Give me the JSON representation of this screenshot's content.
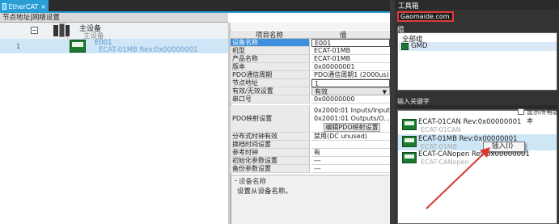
{
  "tab": {
    "label": "EtherCAT",
    "close": "×"
  },
  "left_panel": {
    "header": "节点地址|网络设置",
    "master": {
      "title": "主设备",
      "subtitle": "主设备",
      "collapse": "−"
    },
    "slave": {
      "number": "1",
      "name": "E001",
      "model": "ECAT-01MB Rev:0x00000001"
    }
  },
  "properties": {
    "header": {
      "name": "项目名称",
      "value": "值"
    },
    "rows": [
      {
        "name": "设备名称",
        "value": "E001"
      },
      {
        "name": "机型",
        "value": "ECAT-01MB"
      },
      {
        "name": "产品名称",
        "value": "ECAT-01MB"
      },
      {
        "name": "版本",
        "value": "0x00000001"
      },
      {
        "name": "PDO通信周期",
        "value": "PDO通信周期1 (2000us)"
      },
      {
        "name": "节点地址",
        "value": "1"
      },
      {
        "name": "有效/无效设置",
        "value": "有效"
      },
      {
        "name": "串口号",
        "value": "0x00000000"
      },
      {
        "name": "分布式时钟有效",
        "value": "禁用(DC unused)"
      },
      {
        "name": "换档时间设置",
        "value": ""
      },
      {
        "name": "参考时钟",
        "value": "有"
      },
      {
        "name": "初始化参数设置",
        "value": "---"
      },
      {
        "name": "备份参数设置",
        "value": "---"
      }
    ],
    "pdo": {
      "name": "PDO映射设置",
      "line1": "0x2000:01 Inputs/Input",
      "line2": "0x2001:01 Outputs/O...",
      "button": "编辑PDO映射设置"
    },
    "dropdown_arrow": "▼"
  },
  "description": {
    "title": "设备名称",
    "body": "设置从设备名称。"
  },
  "toolbox": {
    "title": "工具箱",
    "vendor": "Gaomaide.com",
    "group_label": "组",
    "groups": [
      "全部组",
      "GMD"
    ],
    "keyword_label": "输入关键字",
    "show_all": "显示所有版本",
    "devices": [
      {
        "name": "ECAT-01CAN Rev:0x00000001",
        "sub": "ECAT-01CAN"
      },
      {
        "name": "ECAT-01MB Rev:0x00000001",
        "sub": "ECAT-01MB"
      },
      {
        "name": "ECAT-CANopen Rev:0x00000001",
        "sub": "ECAT-CANopen"
      }
    ],
    "context_menu": "插入(I)"
  },
  "colors": {
    "tab_active": "#2a9fd6",
    "selection": "#cfe6f7",
    "highlight_box": "#e23a3a",
    "arrow": "#d9382f",
    "device_icon": "#1d7a2f"
  }
}
